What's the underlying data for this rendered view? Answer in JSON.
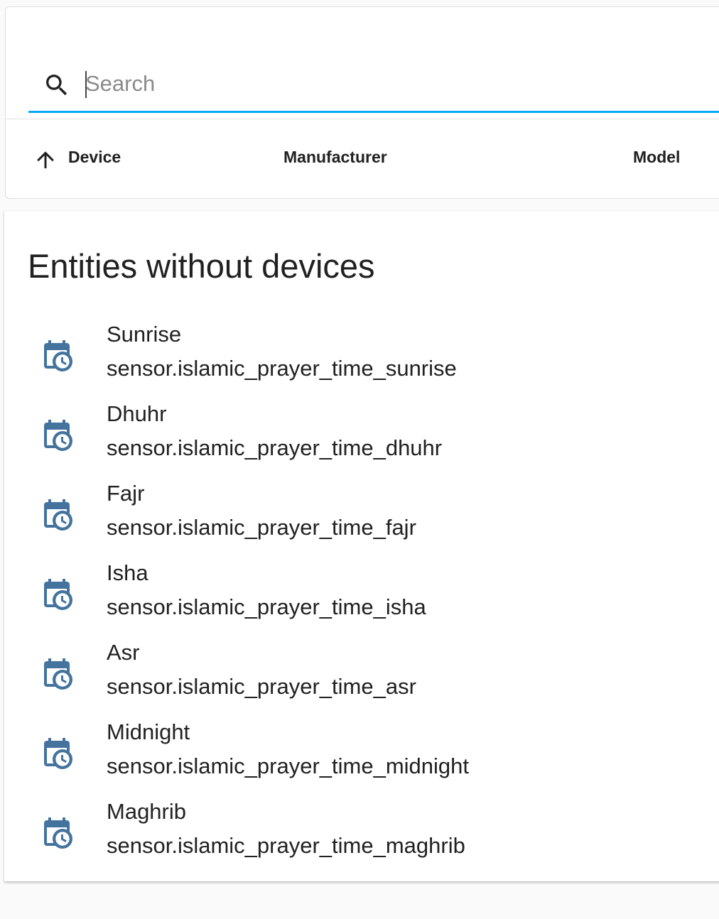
{
  "search": {
    "placeholder": "Search",
    "accent_color": "#03a9f4"
  },
  "table": {
    "sort_icon": "arrow-up-icon",
    "columns": [
      {
        "label": "Device"
      },
      {
        "label": "Manufacturer"
      },
      {
        "label": "Model"
      }
    ]
  },
  "entities": {
    "title": "Entities without devices",
    "icon": "calendar-clock-icon",
    "icon_color": "#44739e",
    "items": [
      {
        "name": "Sunrise",
        "entity_id": "sensor.islamic_prayer_time_sunrise"
      },
      {
        "name": "Dhuhr",
        "entity_id": "sensor.islamic_prayer_time_dhuhr"
      },
      {
        "name": "Fajr",
        "entity_id": "sensor.islamic_prayer_time_fajr"
      },
      {
        "name": "Isha",
        "entity_id": "sensor.islamic_prayer_time_isha"
      },
      {
        "name": "Asr",
        "entity_id": "sensor.islamic_prayer_time_asr"
      },
      {
        "name": "Midnight",
        "entity_id": "sensor.islamic_prayer_time_midnight"
      },
      {
        "name": "Maghrib",
        "entity_id": "sensor.islamic_prayer_time_maghrib"
      }
    ]
  }
}
